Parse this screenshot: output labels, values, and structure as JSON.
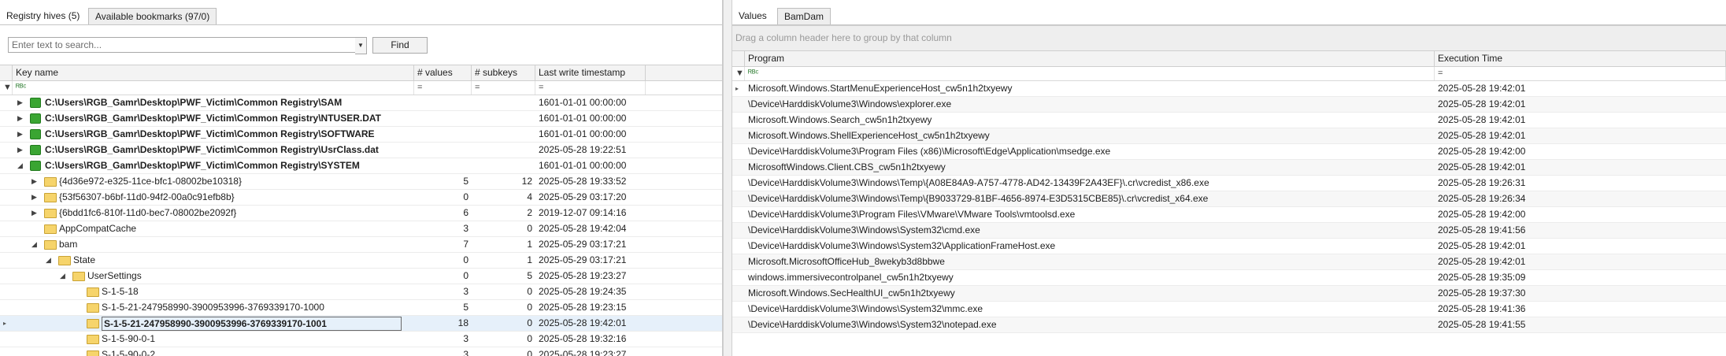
{
  "left": {
    "tabs": [
      {
        "label": "Registry hives (5)"
      },
      {
        "label": "Available bookmarks (97/0)"
      }
    ],
    "search": {
      "placeholder": "Enter text to search...",
      "find_label": "Find"
    },
    "columns": [
      "Key name",
      "# values",
      "# subkeys",
      "Last write timestamp"
    ],
    "rows": [
      {
        "name": "C:\\Users\\RGB_Gamr\\Desktop\\PWF_Victim\\Common Registry\\SAM",
        "values": "",
        "subkeys": "",
        "ts": "1601-01-01 00:00:00"
      },
      {
        "name": "C:\\Users\\RGB_Gamr\\Desktop\\PWF_Victim\\Common Registry\\NTUSER.DAT",
        "values": "",
        "subkeys": "",
        "ts": "1601-01-01 00:00:00"
      },
      {
        "name": "C:\\Users\\RGB_Gamr\\Desktop\\PWF_Victim\\Common Registry\\SOFTWARE",
        "values": "",
        "subkeys": "",
        "ts": "1601-01-01 00:00:00"
      },
      {
        "name": "C:\\Users\\RGB_Gamr\\Desktop\\PWF_Victim\\Common Registry\\UsrClass.dat",
        "values": "",
        "subkeys": "",
        "ts": "2025-05-28 19:22:51"
      },
      {
        "name": "C:\\Users\\RGB_Gamr\\Desktop\\PWF_Victim\\Common Registry\\SYSTEM",
        "values": "",
        "subkeys": "",
        "ts": "1601-01-01 00:00:00"
      },
      {
        "name": "{4d36e972-e325-11ce-bfc1-08002be10318}",
        "values": "5",
        "subkeys": "12",
        "ts": "2025-05-28 19:33:52"
      },
      {
        "name": "{53f56307-b6bf-11d0-94f2-00a0c91efb8b}",
        "values": "0",
        "subkeys": "4",
        "ts": "2025-05-29 03:17:20"
      },
      {
        "name": "{6bdd1fc6-810f-11d0-bec7-08002be2092f}",
        "values": "6",
        "subkeys": "2",
        "ts": "2019-12-07 09:14:16"
      },
      {
        "name": "AppCompatCache",
        "values": "3",
        "subkeys": "0",
        "ts": "2025-05-28 19:42:04"
      },
      {
        "name": "bam",
        "values": "7",
        "subkeys": "1",
        "ts": "2025-05-29 03:17:21"
      },
      {
        "name": "State",
        "values": "0",
        "subkeys": "1",
        "ts": "2025-05-29 03:17:21"
      },
      {
        "name": "UserSettings",
        "values": "0",
        "subkeys": "5",
        "ts": "2025-05-28 19:23:27"
      },
      {
        "name": "S-1-5-18",
        "values": "3",
        "subkeys": "0",
        "ts": "2025-05-28 19:24:35"
      },
      {
        "name": "S-1-5-21-247958990-3900953996-3769339170-1000",
        "values": "5",
        "subkeys": "0",
        "ts": "2025-05-28 19:23:15"
      },
      {
        "name": "S-1-5-21-247958990-3900953996-3769339170-1001",
        "values": "18",
        "subkeys": "0",
        "ts": "2025-05-28 19:42:01"
      },
      {
        "name": "S-1-5-90-0-1",
        "values": "3",
        "subkeys": "0",
        "ts": "2025-05-28 19:32:16"
      },
      {
        "name": "S-1-5-90-0-2",
        "values": "3",
        "subkeys": "0",
        "ts": "2025-05-28 19:23:27"
      }
    ]
  },
  "right": {
    "tabs": [
      {
        "label": "Values"
      },
      {
        "label": "BamDam"
      }
    ],
    "group_hint": "Drag a column header here to group by that column",
    "columns": [
      "Program",
      "Execution Time"
    ],
    "rows": [
      {
        "program": "Microsoft.Windows.StartMenuExperienceHost_cw5n1h2txyewy",
        "time": "2025-05-28 19:42:01"
      },
      {
        "program": "\\Device\\HarddiskVolume3\\Windows\\explorer.exe",
        "time": "2025-05-28 19:42:01"
      },
      {
        "program": "Microsoft.Windows.Search_cw5n1h2txyewy",
        "time": "2025-05-28 19:42:01"
      },
      {
        "program": "Microsoft.Windows.ShellExperienceHost_cw5n1h2txyewy",
        "time": "2025-05-28 19:42:01"
      },
      {
        "program": "\\Device\\HarddiskVolume3\\Program Files (x86)\\Microsoft\\Edge\\Application\\msedge.exe",
        "time": "2025-05-28 19:42:00"
      },
      {
        "program": "MicrosoftWindows.Client.CBS_cw5n1h2txyewy",
        "time": "2025-05-28 19:42:01"
      },
      {
        "program": "\\Device\\HarddiskVolume3\\Windows\\Temp\\{A08E84A9-A757-4778-AD42-13439F2A43EF}\\.cr\\vcredist_x86.exe",
        "time": "2025-05-28 19:26:31"
      },
      {
        "program": "\\Device\\HarddiskVolume3\\Windows\\Temp\\{B9033729-81BF-4656-8974-E3D5315CBE85}\\.cr\\vcredist_x64.exe",
        "time": "2025-05-28 19:26:34"
      },
      {
        "program": "\\Device\\HarddiskVolume3\\Program Files\\VMware\\VMware Tools\\vmtoolsd.exe",
        "time": "2025-05-28 19:42:00"
      },
      {
        "program": "\\Device\\HarddiskVolume3\\Windows\\System32\\cmd.exe",
        "time": "2025-05-28 19:41:56"
      },
      {
        "program": "\\Device\\HarddiskVolume3\\Windows\\System32\\ApplicationFrameHost.exe",
        "time": "2025-05-28 19:42:01"
      },
      {
        "program": "Microsoft.MicrosoftOfficeHub_8wekyb3d8bbwe",
        "time": "2025-05-28 19:42:01"
      },
      {
        "program": "windows.immersivecontrolpanel_cw5n1h2txyewy",
        "time": "2025-05-28 19:35:09"
      },
      {
        "program": "Microsoft.Windows.SecHealthUI_cw5n1h2txyewy",
        "time": "2025-05-28 19:37:30"
      },
      {
        "program": "\\Device\\HarddiskVolume3\\Windows\\System32\\mmc.exe",
        "time": "2025-05-28 19:41:36"
      },
      {
        "program": "\\Device\\HarddiskVolume3\\Windows\\System32\\notepad.exe",
        "time": "2025-05-28 19:41:55"
      }
    ]
  },
  "colors": {
    "hive_icon": "#3aa532",
    "folder_icon": "#f6d46b",
    "selected_row": "#e6f0fa"
  }
}
